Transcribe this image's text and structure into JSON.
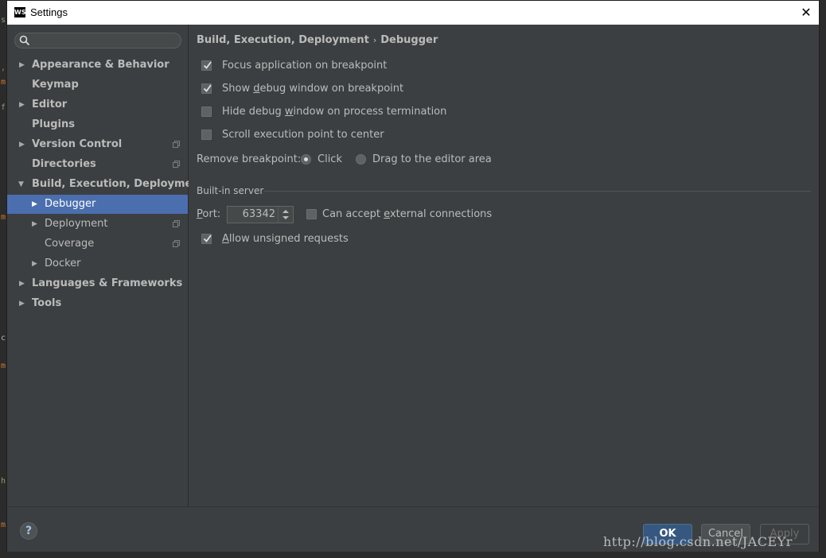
{
  "window": {
    "title": "Settings",
    "logo_text": "WS"
  },
  "search": {
    "placeholder": ""
  },
  "tree": [
    {
      "label": "Appearance & Behavior",
      "arrow": "▶",
      "shared": false
    },
    {
      "label": "Keymap",
      "arrow": "",
      "shared": false
    },
    {
      "label": "Editor",
      "arrow": "▶",
      "shared": false
    },
    {
      "label": "Plugins",
      "arrow": "",
      "shared": false
    },
    {
      "label": "Version Control",
      "arrow": "▶",
      "shared": true
    },
    {
      "label": "Directories",
      "arrow": "",
      "shared": true
    },
    {
      "label": "Build, Execution, Deployment",
      "arrow": "▼",
      "shared": false
    },
    {
      "label": "Debugger",
      "arrow": "▶",
      "shared": false,
      "selected": true
    },
    {
      "label": "Deployment",
      "arrow": "▶",
      "shared": true
    },
    {
      "label": "Coverage",
      "arrow": "",
      "shared": true
    },
    {
      "label": "Docker",
      "arrow": "▶",
      "shared": false
    },
    {
      "label": "Languages & Frameworks",
      "arrow": "▶",
      "shared": false
    },
    {
      "label": "Tools",
      "arrow": "▶",
      "shared": false
    }
  ],
  "breadcrumb": {
    "parent": "Build, Execution, Deployment",
    "separator": "›",
    "current": "Debugger"
  },
  "options": {
    "focus_app": {
      "label": "Focus application on breakpoint",
      "checked": true
    },
    "show_debug_window": {
      "pre": "Show ",
      "mnemonic": "d",
      "post": "ebug window on breakpoint",
      "checked": true
    },
    "hide_debug_window": {
      "pre": "Hide debug ",
      "mnemonic": "w",
      "post": "indow on process termination",
      "checked": false
    },
    "scroll_exec_point": {
      "label": "Scroll execution point to center",
      "checked": false
    }
  },
  "remove_breakpoint": {
    "label": "Remove breakpoint:",
    "options": [
      {
        "label": "Click",
        "selected": true
      },
      {
        "label": "Drag to the editor area",
        "selected": false
      }
    ]
  },
  "builtin_server": {
    "title": "Built-in server",
    "port_mnemonic": "P",
    "port_rest": "ort:",
    "port_value": "63342",
    "external": {
      "pre": "Can accept ",
      "mnemonic": "e",
      "post": "xternal connections",
      "checked": false
    },
    "unsigned": {
      "mnemonic": "A",
      "post": "llow unsigned requests",
      "checked": true
    }
  },
  "footer": {
    "help": "?",
    "ok": "OK",
    "cancel": "Cancel",
    "apply": "Apply"
  },
  "watermark": "http://blog.csdn.net/JACEYr",
  "colors": {
    "selection": "#4b6eaf",
    "panel": "#3c3f41",
    "ok_button": "#365880"
  }
}
